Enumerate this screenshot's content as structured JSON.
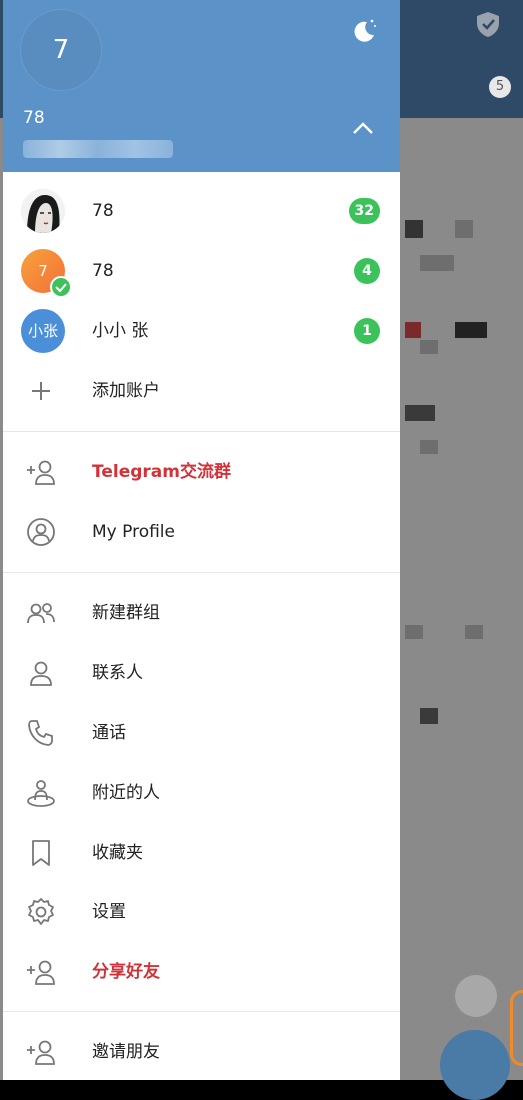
{
  "drawer": {
    "avatar_initial": "7",
    "user_name": "78",
    "accounts": [
      {
        "name": "78",
        "count": "32"
      },
      {
        "name": "78",
        "initial": "7",
        "count": "4"
      },
      {
        "name": "小小 张",
        "initial": "小张",
        "count": "1"
      }
    ],
    "add_account": "添加账户",
    "menu_top": [
      {
        "label": "Telegram交流群",
        "icon": "add-user-icon",
        "highlight": true
      },
      {
        "label": "My Profile",
        "icon": "profile-icon",
        "highlight": false
      }
    ],
    "menu_main": [
      {
        "label": "新建群组",
        "icon": "group-icon"
      },
      {
        "label": "联系人",
        "icon": "contact-icon"
      },
      {
        "label": "通话",
        "icon": "phone-icon"
      },
      {
        "label": "附近的人",
        "icon": "nearby-icon"
      },
      {
        "label": "收藏夹",
        "icon": "bookmark-icon"
      },
      {
        "label": "设置",
        "icon": "settings-icon"
      },
      {
        "label": "分享好友",
        "icon": "add-user-icon",
        "highlight": true
      }
    ],
    "invite": "邀请朋友"
  },
  "background": {
    "unread_badge": "5"
  },
  "colors": {
    "header": "#5b93c9",
    "badge": "#3cc25b",
    "highlight": "#d0333a"
  }
}
